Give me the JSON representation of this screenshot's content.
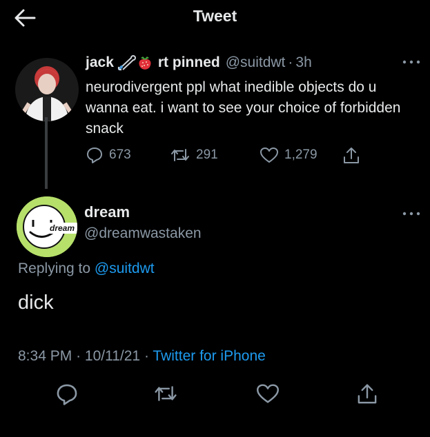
{
  "header": {
    "title": "Tweet",
    "back_icon": "arrow-left-icon"
  },
  "parent_tweet": {
    "name": "jack",
    "name_suffix": "rt pinned",
    "badges": [
      "safety-pin-icon",
      "strawberry-icon"
    ],
    "handle": "@suitdwt",
    "separator": "·",
    "time": "3h",
    "text": "neurodivergent ppl what inedible objects do u wanna eat. i want to see your choice of forbidden snack",
    "stats": {
      "replies": "673",
      "retweets": "291",
      "likes": "1,279"
    }
  },
  "main_tweet": {
    "name": "dream",
    "handle": "@dreamwastaken",
    "avatar_label": "dream",
    "replying_prefix": "Replying to",
    "replying_handle": "@suitdwt",
    "text": "dick",
    "time": "8:34 PM",
    "date": "10/11/21",
    "meta_sep": "·",
    "source": "Twitter for iPhone"
  },
  "colors": {
    "background": "#000000",
    "text": "#e7e9ea",
    "muted": "#8b98a5",
    "link": "#1d9bf0",
    "avatar_green": "#b6e06a"
  }
}
